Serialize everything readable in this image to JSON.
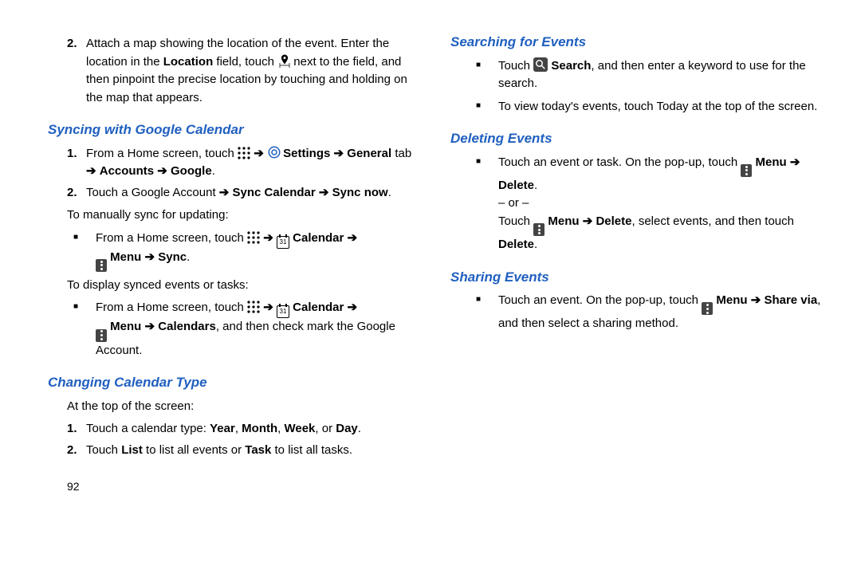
{
  "left": {
    "item2": {
      "num": "2.",
      "t1": "Attach a map showing the location of the event. Enter the location in the ",
      "b1": "Location",
      "t2": " field, touch ",
      "t3": " next to the field, and then pinpoint the precise location by touching and holding on the map that appears."
    },
    "h1": "Syncing with Google Calendar",
    "s1": {
      "n1": "1.",
      "n1t1": "From a Home screen, touch ",
      "n1b1": "Settings",
      "n1b2": "General",
      "n1t2": " tab ",
      "n1b3": "Accounts",
      "n1b4": "Google",
      "n2": "2.",
      "n2t1": "Touch a Google Account ",
      "n2b1": "Sync Calendar",
      "n2b2": "Sync now"
    },
    "p1": "To manually sync for updating:",
    "b1": {
      "t1": "From a Home screen, touch ",
      "calb": "Calendar",
      "menub": "Menu",
      "syncb": "Sync"
    },
    "p2": "To display synced events or tasks:",
    "b2": {
      "t1": "From a Home screen, touch ",
      "calb": "Calendar",
      "menub": "Menu",
      "calsb": "Calendars",
      "t2": ", and then check mark the Google Account."
    },
    "h2": "Changing Calendar Type",
    "p3": "At the top of the screen:",
    "ct": {
      "n1": "1.",
      "n1t1": "Touch a calendar type: ",
      "n1b1": "Year",
      "n1b2": "Month",
      "n1b3": "Week",
      "n1b4": "Day",
      "n2": "2.",
      "n2t1": "Touch ",
      "n2b1": "List",
      "n2t2": " to list all events or ",
      "n2b2": "Task",
      "n2t3": " to list all tasks."
    },
    "pageno": "92"
  },
  "right": {
    "h1": "Searching for Events",
    "se": {
      "t1": "Touch ",
      "b1": "Search",
      "t2": ", and then enter a keyword to use for the search.",
      "li2": "To view today's events, touch Today at the top of the screen."
    },
    "h2": "Deleting Events",
    "de": {
      "t1": "Touch an event or task. On the pop-up, touch ",
      "b1": "Menu",
      "b2": "Delete",
      "or": "– or –",
      "t2": "Touch ",
      "b3": "Menu",
      "b4": "Delete",
      "t3": ", select events, and then touch ",
      "b5": "Delete"
    },
    "h3": "Sharing Events",
    "sh": {
      "t1": "Touch an event. On the pop-up, touch ",
      "b1": "Menu",
      "b2": "Share via",
      "t2": ", and then select a sharing method."
    }
  },
  "arrow": "➔"
}
